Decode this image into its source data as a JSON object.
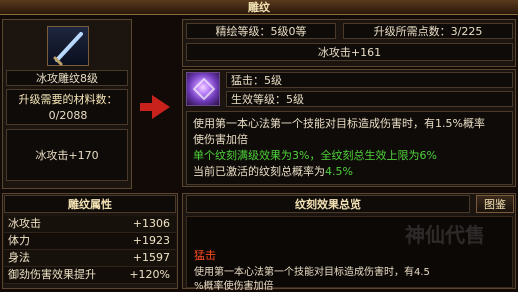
{
  "window": {
    "title": "雕纹"
  },
  "left": {
    "item_name": "冰攻雕纹8级",
    "materials_label": "升级需要的材料数：",
    "materials_value": "0/2088",
    "item_effect": "冰攻击+170"
  },
  "center_top": {
    "level_text": "精绘等级：5级0等",
    "points_text": "升级所需点数：3/225",
    "attack_text": "冰攻击+161"
  },
  "skill": {
    "line1": "猛击：5级",
    "line2": "生效等级：5级"
  },
  "description": {
    "line1": "使用第一本心法第一个技能对目标造成伤害时，有1.5%概率",
    "line2": "使伤害加倍",
    "line3": "单个纹刻满级效果为3%，全纹刻总生效上限为6%",
    "line4_prefix": "当前已激活的纹刻总概率为",
    "line4_value": "4.5%"
  },
  "attributes": {
    "title": "雕纹属性",
    "rows": [
      {
        "label": "冰攻击",
        "value": "+1306"
      },
      {
        "label": "体力",
        "value": "+1923"
      },
      {
        "label": "身法",
        "value": "+1597"
      },
      {
        "label": "御劲伤害效果提升",
        "value": "+120%"
      }
    ]
  },
  "effects": {
    "title": "纹刻效果总览",
    "button": "图鉴",
    "skill_name": "猛击",
    "desc_line1": "使用第一本心法第一个技能对目标造成伤害时，有4.5",
    "desc_line2": "%概率使伤害加倍"
  },
  "watermark": {
    "text": "神仙代售"
  }
}
